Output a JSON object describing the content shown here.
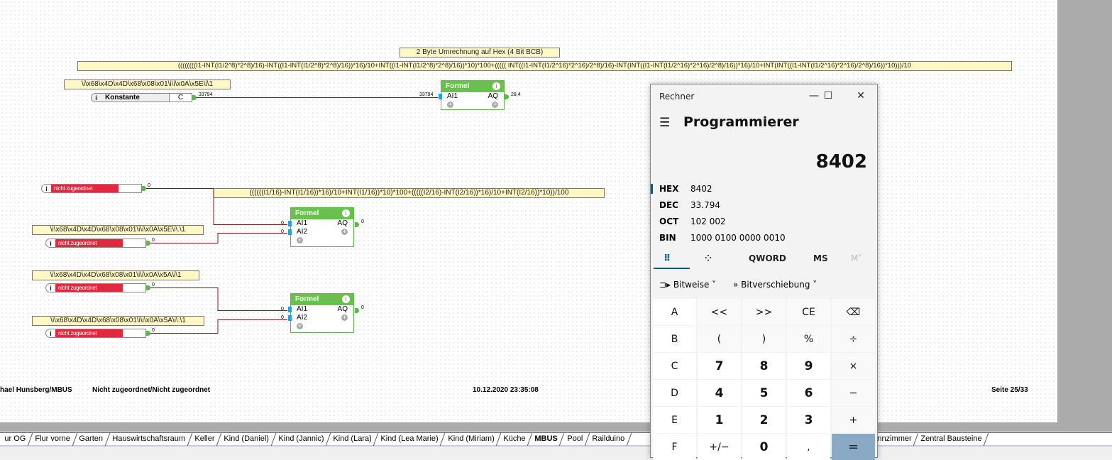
{
  "diagram": {
    "title_note": "2 Byte Umrechnung auf Hex (4 Bit BCB)",
    "formula_main": "((((((((I1-INT(I1/2^8)*2^8)/16)-INT((I1-INT(I1/2^8)*2^8)/16))*16)/10+INT((I1-INT(I1/2^8)*2^8)/16))*10)*100+((((( INT((I1-INT(I1/2^16)*2^16)/2^8)/16)-INT(INT((I1-INT(I1/2^16)*2^16)/2^8)/16))*16)/10+INT(INT((I1-INT(I1/2^16)*2^16)/2^8)/16))*10)))/10",
    "label1": "\\i\\x68\\x4D\\x4D\\x68\\x08\\x01\\i\\i\\x0A\\x5E\\i\\1",
    "konstante_label": "Konstante",
    "konstante_type": "C",
    "konstante_value": "33794",
    "formel_label": "Formel",
    "ai1": "AI1",
    "ai2": "AI2",
    "aq": "AQ",
    "info": "i",
    "plus": "+",
    "formel1_in": "33794",
    "formel1_out": "28,4",
    "formula2": "((((((I1/16)-INT(I1/16))*16)/10+INT(I1/16))*10)*100+(((((I2/16)-INT(I2/16))*16)/10+INT(I2/16))*10))/100",
    "not_assigned": "nicht zugeordnet",
    "zero": "0",
    "label2": "\\i\\x68\\x4D\\x4D\\x68\\x08\\x01\\i\\i\\x0A\\x5E\\i\\.\\1",
    "label3": "\\i\\x68\\x4D\\x4D\\x68\\x08\\x01\\i\\i\\x0A\\x5A\\i\\1",
    "label4": "\\i\\x68\\x4D\\x4D\\x68\\x08\\x01\\i\\i\\x0A\\x5A\\i\\.\\1"
  },
  "footer": {
    "author": "hael Hunsberg/MBUS",
    "assignment": "Nicht zugeordnet/Nicht zugeordnet",
    "datetime": "10.12.2020 23:35:08",
    "page": "Seite 25/33"
  },
  "tabs": [
    {
      "label": "ur OG"
    },
    {
      "label": "Flur vorne"
    },
    {
      "label": "Garten"
    },
    {
      "label": "Hauswirtschaftsraum"
    },
    {
      "label": "Keller"
    },
    {
      "label": "Kind (Daniel)"
    },
    {
      "label": "Kind (Jannic)"
    },
    {
      "label": "Kind (Lara)"
    },
    {
      "label": "Kind (Lea Marie)"
    },
    {
      "label": "Kind (Miriam)"
    },
    {
      "label": "Küche"
    },
    {
      "label": "MBUS",
      "active": true
    },
    {
      "label": "Pool"
    },
    {
      "label": "Railduino"
    }
  ],
  "tabs_right": [
    {
      "label": "nnzimmer"
    },
    {
      "label": "Zentral Bausteine"
    }
  ],
  "calculator": {
    "window_title": "Rechner",
    "mode": "Programmierer",
    "display": "8402",
    "radix": [
      {
        "name": "HEX",
        "value": "8402"
      },
      {
        "name": "DEC",
        "value": "33.794"
      },
      {
        "name": "OCT",
        "value": "102 002"
      },
      {
        "name": "BIN",
        "value": "1000 0100 0000 0010"
      }
    ],
    "toolbar": {
      "word": "QWORD",
      "ms": "MS",
      "mv": "M˅",
      "bitwise": "Bitweise",
      "bitshift": "Bitverschiebung"
    },
    "keys": [
      [
        "A",
        "<<",
        ">>",
        "CE",
        "⌫"
      ],
      [
        "B",
        "(",
        ")",
        "%",
        "÷"
      ],
      [
        "C",
        "7",
        "8",
        "9",
        "×"
      ],
      [
        "D",
        "4",
        "5",
        "6",
        "−"
      ],
      [
        "E",
        "1",
        "2",
        "3",
        "+"
      ],
      [
        "F",
        "+/−",
        "0",
        ",",
        "="
      ]
    ],
    "accent": "#005a9e"
  }
}
